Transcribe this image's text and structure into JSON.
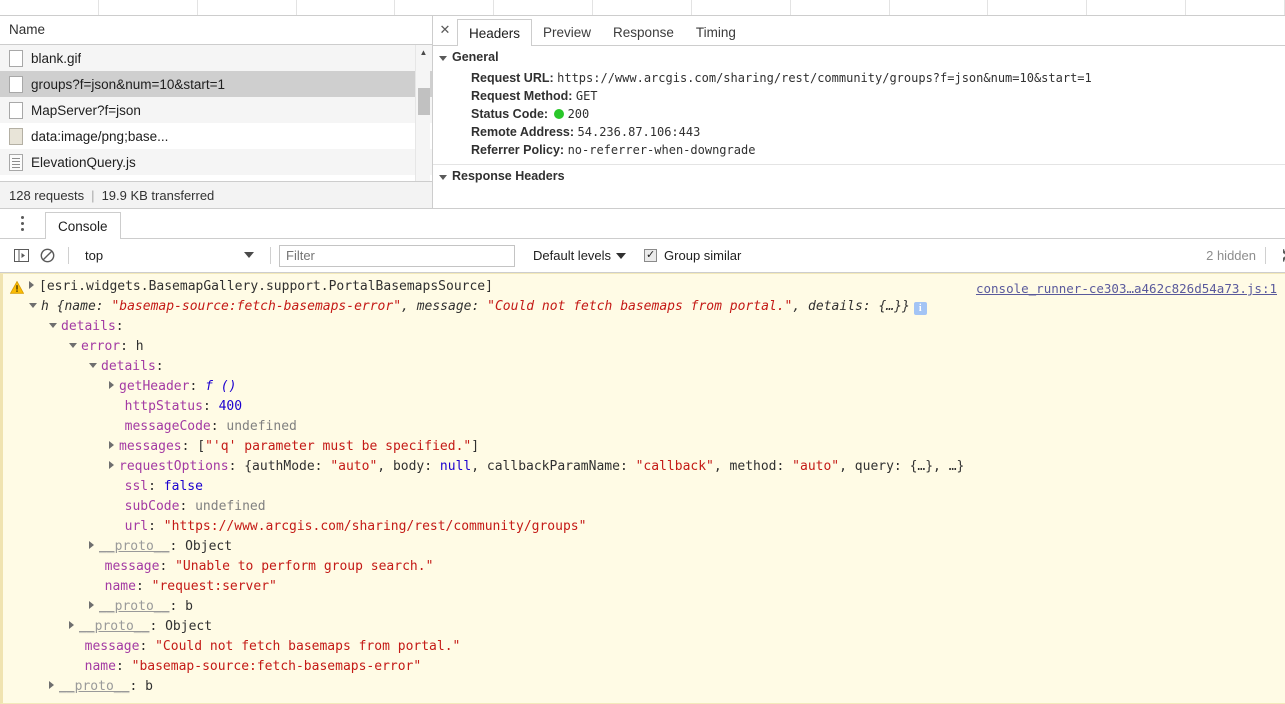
{
  "top_toolbar": {
    "segment_count": 13
  },
  "network_panel": {
    "column_header": "Name",
    "rows": [
      {
        "label": "blank.gif",
        "icon": "file-icon",
        "selected": false
      },
      {
        "label": "groups?f=json&num=10&start=1",
        "icon": "file-icon",
        "selected": true
      },
      {
        "label": "MapServer?f=json",
        "icon": "file-icon",
        "selected": false
      },
      {
        "label": "data:image/png;base...",
        "icon": "image-file-icon",
        "selected": false
      },
      {
        "label": "ElevationQuery.js",
        "icon": "script-file-icon",
        "selected": false
      }
    ],
    "status": {
      "requests": "128 requests",
      "separator": "|",
      "transferred": "19.9 KB transferred"
    },
    "scrollbar": {
      "up_arrow": "▲",
      "down_arrow": "▼"
    }
  },
  "details_panel": {
    "close_label": "✕",
    "tabs": [
      {
        "label": "Headers",
        "active": true
      },
      {
        "label": "Preview",
        "active": false
      },
      {
        "label": "Response",
        "active": false
      },
      {
        "label": "Timing",
        "active": false
      }
    ],
    "general_section": {
      "title": "General",
      "rows": [
        {
          "key": "Request URL:",
          "value": "https://www.arcgis.com/sharing/rest/community/groups?f=json&num=10&start=1"
        },
        {
          "key": "Request Method:",
          "value": "GET"
        },
        {
          "key": "Status Code:",
          "value": "200",
          "dot_color": "#2ac72a"
        },
        {
          "key": "Remote Address:",
          "value": "54.236.87.106:443"
        },
        {
          "key": "Referrer Policy:",
          "value": "no-referrer-when-downgrade"
        }
      ]
    },
    "response_headers_section": {
      "title": "Response Headers"
    }
  },
  "console_panel": {
    "tab_label": "Console",
    "kebab_icon": "more-options-icon",
    "toolbar": {
      "sidebar_icon": "console-sidebar-icon",
      "clear_icon": "clear-console-icon",
      "context_value": "top",
      "filter_placeholder": "Filter",
      "filter_value": "",
      "levels_label": "Default levels",
      "group_similar_label": "Group similar",
      "group_similar_checked": true,
      "hidden_count": "2 hidden",
      "settings_icon": "gear-icon"
    },
    "message": {
      "level": "warning",
      "source_link": "console_runner-ce303…a462c826d54a73.js:1",
      "lines": [
        {
          "indent": 0,
          "arrow": "closed",
          "parts": [
            {
              "t": "[esri.widgets.BasemapGallery.support.PortalBasemapsSource]",
              "c": "plain"
            }
          ]
        },
        {
          "indent": 1,
          "arrow": "open",
          "parts": [
            {
              "t": "h ",
              "c": "plain ital"
            },
            {
              "t": "{name: ",
              "c": "plain ital"
            },
            {
              "t": "\"basemap-source:fetch-basemaps-error\"",
              "c": "str ital"
            },
            {
              "t": ", message: ",
              "c": "plain ital"
            },
            {
              "t": "\"Could not fetch basemaps from portal.\"",
              "c": "str ital"
            },
            {
              "t": ", details: {…}}",
              "c": "plain ital"
            },
            {
              "t": "i",
              "c": "badge"
            }
          ]
        },
        {
          "indent": 2,
          "arrow": "open",
          "parts": [
            {
              "t": "details",
              "c": "prop"
            },
            {
              "t": ":",
              "c": "plain"
            }
          ]
        },
        {
          "indent": 3,
          "arrow": "open",
          "parts": [
            {
              "t": "error",
              "c": "prop"
            },
            {
              "t": ": h",
              "c": "plain"
            }
          ]
        },
        {
          "indent": 4,
          "arrow": "open",
          "parts": [
            {
              "t": "details",
              "c": "prop"
            },
            {
              "t": ":",
              "c": "plain"
            }
          ]
        },
        {
          "indent": 5,
          "arrow": "closed",
          "parts": [
            {
              "t": "getHeader",
              "c": "prop"
            },
            {
              "t": ": ",
              "c": "plain"
            },
            {
              "t": "f ()",
              "c": "fn"
            }
          ]
        },
        {
          "indent": 5,
          "arrow": "none",
          "parts": [
            {
              "t": "httpStatus",
              "c": "prop"
            },
            {
              "t": ": ",
              "c": "plain"
            },
            {
              "t": "400",
              "c": "num"
            }
          ]
        },
        {
          "indent": 5,
          "arrow": "none",
          "parts": [
            {
              "t": "messageCode",
              "c": "prop"
            },
            {
              "t": ": ",
              "c": "plain"
            },
            {
              "t": "undefined",
              "c": "undef"
            }
          ]
        },
        {
          "indent": 5,
          "arrow": "closed",
          "parts": [
            {
              "t": "messages",
              "c": "prop"
            },
            {
              "t": ": [",
              "c": "plain"
            },
            {
              "t": "\"'q' parameter must be specified.\"",
              "c": "str"
            },
            {
              "t": "]",
              "c": "plain"
            }
          ]
        },
        {
          "indent": 5,
          "arrow": "closed",
          "parts": [
            {
              "t": "requestOptions",
              "c": "prop"
            },
            {
              "t": ": {authMode: ",
              "c": "plain"
            },
            {
              "t": "\"auto\"",
              "c": "str"
            },
            {
              "t": ", body: ",
              "c": "plain"
            },
            {
              "t": "null",
              "c": "bool"
            },
            {
              "t": ", callbackParamName: ",
              "c": "plain"
            },
            {
              "t": "\"callback\"",
              "c": "str"
            },
            {
              "t": ", method: ",
              "c": "plain"
            },
            {
              "t": "\"auto\"",
              "c": "str"
            },
            {
              "t": ", query: {…}, …}",
              "c": "plain"
            }
          ]
        },
        {
          "indent": 5,
          "arrow": "none",
          "parts": [
            {
              "t": "ssl",
              "c": "prop"
            },
            {
              "t": ": ",
              "c": "plain"
            },
            {
              "t": "false",
              "c": "bool"
            }
          ]
        },
        {
          "indent": 5,
          "arrow": "none",
          "parts": [
            {
              "t": "subCode",
              "c": "prop"
            },
            {
              "t": ": ",
              "c": "plain"
            },
            {
              "t": "undefined",
              "c": "undef"
            }
          ]
        },
        {
          "indent": 5,
          "arrow": "none",
          "parts": [
            {
              "t": "url",
              "c": "prop"
            },
            {
              "t": ": ",
              "c": "plain"
            },
            {
              "t": "\"https://www.arcgis.com/sharing/rest/community/groups\"",
              "c": "str"
            }
          ]
        },
        {
          "indent": 4,
          "arrow": "closed",
          "parts": [
            {
              "t": "__proto__",
              "c": "proto"
            },
            {
              "t": ": Object",
              "c": "plain"
            }
          ]
        },
        {
          "indent": 4,
          "arrow": "none",
          "parts": [
            {
              "t": "message",
              "c": "prop"
            },
            {
              "t": ": ",
              "c": "plain"
            },
            {
              "t": "\"Unable to perform group search.\"",
              "c": "str"
            }
          ]
        },
        {
          "indent": 4,
          "arrow": "none",
          "parts": [
            {
              "t": "name",
              "c": "prop"
            },
            {
              "t": ": ",
              "c": "plain"
            },
            {
              "t": "\"request:server\"",
              "c": "str"
            }
          ]
        },
        {
          "indent": 4,
          "arrow": "closed",
          "parts": [
            {
              "t": "__proto__",
              "c": "proto"
            },
            {
              "t": ": b",
              "c": "plain"
            }
          ]
        },
        {
          "indent": 3,
          "arrow": "closed",
          "parts": [
            {
              "t": "__proto__",
              "c": "proto"
            },
            {
              "t": ": Object",
              "c": "plain"
            }
          ]
        },
        {
          "indent": 3,
          "arrow": "none",
          "parts": [
            {
              "t": "message",
              "c": "prop"
            },
            {
              "t": ": ",
              "c": "plain"
            },
            {
              "t": "\"Could not fetch basemaps from portal.\"",
              "c": "str"
            }
          ]
        },
        {
          "indent": 3,
          "arrow": "none",
          "parts": [
            {
              "t": "name",
              "c": "prop"
            },
            {
              "t": ": ",
              "c": "plain"
            },
            {
              "t": "\"basemap-source:fetch-basemaps-error\"",
              "c": "str"
            }
          ]
        },
        {
          "indent": 2,
          "arrow": "closed",
          "parts": [
            {
              "t": "__proto__",
              "c": "proto"
            },
            {
              "t": ": b",
              "c": "plain"
            }
          ]
        }
      ]
    }
  },
  "colors": {
    "warning_bg": "#fffbe5",
    "warning_border": "#f3e9ba",
    "status_ok": "#2ac72a",
    "selection": "#cfcfcf",
    "string": "#c41a16",
    "property": "#a33aa3",
    "number": "#1c00cf",
    "link": "#5a5a9c"
  }
}
